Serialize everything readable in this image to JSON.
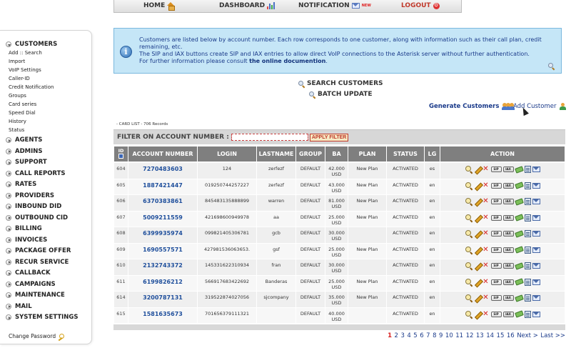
{
  "topnav": {
    "items": [
      {
        "label": "HOME",
        "icon": "home-icon"
      },
      {
        "label": "DASHBOARD",
        "icon": "chart-icon"
      },
      {
        "label": "NOTIFICATION",
        "icon": "mail-icon",
        "badge": "NEW"
      },
      {
        "label": "LOGOUT",
        "icon": "power-icon"
      }
    ]
  },
  "sidebar": {
    "sections": [
      {
        "label": "CUSTOMERS",
        "expanded": true,
        "items": [
          "Add :: Search",
          "Import",
          "VoIP Settings",
          "Caller-ID",
          "Credit Notification",
          "Groups",
          "Card series",
          "Speed Dial",
          "History",
          "Status"
        ]
      },
      {
        "label": "AGENTS"
      },
      {
        "label": "ADMINS"
      },
      {
        "label": "SUPPORT"
      },
      {
        "label": "CALL REPORTS"
      },
      {
        "label": "RATES"
      },
      {
        "label": "PROVIDERS"
      },
      {
        "label": "INBOUND DID"
      },
      {
        "label": "OUTBOUND CID"
      },
      {
        "label": "BILLING"
      },
      {
        "label": "INVOICES"
      },
      {
        "label": "PACKAGE OFFER"
      },
      {
        "label": "RECUR SERVICE"
      },
      {
        "label": "CALLBACK"
      },
      {
        "label": "CAMPAIGNS"
      },
      {
        "label": "MAINTENANCE"
      },
      {
        "label": "MAIL"
      },
      {
        "label": "SYSTEM SETTINGS"
      }
    ],
    "change_password": "Change Password"
  },
  "info": {
    "line1": "Customers are listed below by account number. Each row corresponds to one customer, along with information such as their call plan, credit remaining, etc.",
    "line2": "The SIP and IAX buttons create SIP and IAX entries to allow direct VoIP connections to the Asterisk server without further authentication.",
    "line3_prefix": "For further information please consult ",
    "line3_link": "the online documention",
    "line3_suffix": "."
  },
  "search_customers": "SEARCH CUSTOMERS",
  "batch_update": "BATCH UPDATE",
  "generate_customers": "Generate Customers",
  "add_customer": "Add Customer",
  "card_list": "- CARD LIST - 706 Records",
  "filter": {
    "label": "FILTER ON ACCOUNT NUMBER :",
    "value": "",
    "button": "APPLY FILTER"
  },
  "table": {
    "headers": {
      "id": "ID",
      "account": "ACCOUNT NUMBER",
      "login": "LOGIN",
      "lastname": "LASTNAME",
      "group": "GROUP",
      "ba": "BA",
      "plan": "PLAN",
      "status": "STATUS",
      "lg": "LG",
      "action": "ACTION"
    },
    "rows": [
      {
        "id": "604",
        "account": "7270483603",
        "login": "124",
        "lastname": "zerfezf",
        "group": "DEFAULT",
        "ba": "42.000",
        "currency": "USD",
        "plan": "New Plan",
        "status": "ACTIVATED",
        "lg": "es"
      },
      {
        "id": "605",
        "account": "1887421447",
        "login": "019250744257227",
        "lastname": "zerfezf",
        "group": "DEFAULT",
        "ba": "43.000",
        "currency": "USD",
        "plan": "New Plan",
        "status": "ACTIVATED",
        "lg": "en"
      },
      {
        "id": "606",
        "account": "6370383861",
        "login": "845483135888899",
        "lastname": "warren",
        "group": "DEFAULT",
        "ba": "81.000",
        "currency": "USD",
        "plan": "New Plan",
        "status": "ACTIVATED",
        "lg": "en"
      },
      {
        "id": "607",
        "account": "5009211559",
        "login": "421698600949978",
        "lastname": "aa",
        "group": "DEFAULT",
        "ba": "25.000",
        "currency": "USD",
        "plan": "New Plan",
        "status": "ACTIVATED",
        "lg": "en"
      },
      {
        "id": "608",
        "account": "6399935974",
        "login": "099821405306781",
        "lastname": "gcb",
        "group": "DEFAULT",
        "ba": "30.000",
        "currency": "USD",
        "plan": "",
        "status": "ACTIVATED",
        "lg": "en"
      },
      {
        "id": "609",
        "account": "1690557571",
        "login": "427981536063653.",
        "lastname": "gsf",
        "group": "DEFAULT",
        "ba": "25.000",
        "currency": "USD",
        "plan": "New Plan",
        "status": "ACTIVATED",
        "lg": "en"
      },
      {
        "id": "610",
        "account": "2132743372",
        "login": "145331622310934",
        "lastname": "fran",
        "group": "DEFAULT",
        "ba": "30.000",
        "currency": "USD",
        "plan": "",
        "status": "ACTIVATED",
        "lg": "en"
      },
      {
        "id": "611",
        "account": "6199826212",
        "login": "566917683422692",
        "lastname": "Banderas",
        "group": "DEFAULT",
        "ba": "25.000",
        "currency": "USD",
        "plan": "New Plan",
        "status": "ACTIVATED",
        "lg": "en"
      },
      {
        "id": "614",
        "account": "3200787131",
        "login": "319522874027056",
        "lastname": "sjcompany",
        "group": "DEFAULT",
        "ba": "35.000",
        "currency": "USD",
        "plan": "New Plan",
        "status": "ACTIVATED",
        "lg": "en"
      },
      {
        "id": "615",
        "account": "1581635673",
        "login": "701656379111321",
        "lastname": "",
        "group": "DEFAULT",
        "ba": "40.000",
        "currency": "USD",
        "plan": "",
        "status": "ACTIVATED",
        "lg": "en"
      }
    ],
    "action_icons": [
      "magnifier-icon",
      "edit-icon",
      "delete-icon",
      "sip-icon",
      "iax-icon",
      "money-icon",
      "invoice-icon",
      "mail-icon"
    ]
  },
  "pager": {
    "current": "1",
    "pages": [
      "1",
      "2",
      "3",
      "4",
      "5",
      "6",
      "7",
      "8",
      "9",
      "10",
      "11",
      "12",
      "13",
      "14",
      "15",
      "16"
    ],
    "next": "Next >",
    "last": "Last >>"
  },
  "colors": {
    "info_bg": "#c5e6f7",
    "header_bg": "#7f7f7f",
    "link": "#1f4f9c",
    "accent_red": "#d71f1f"
  }
}
